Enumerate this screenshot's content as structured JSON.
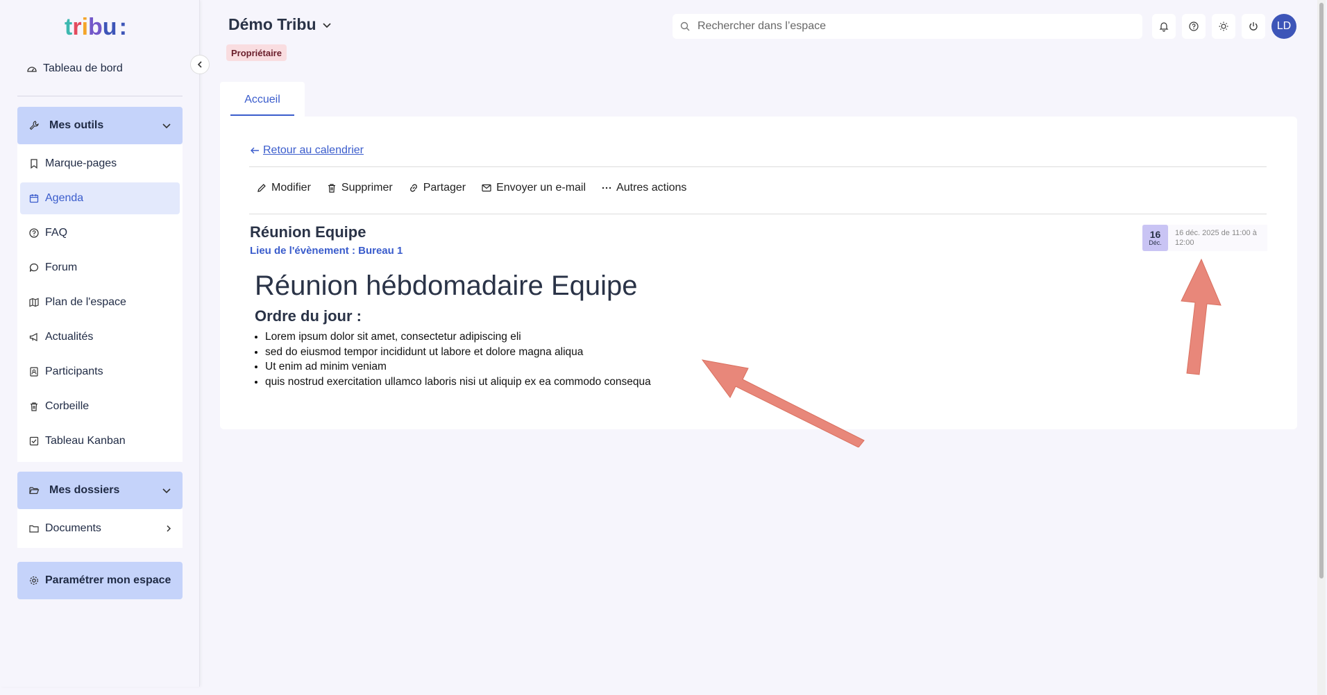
{
  "logo": {
    "text": "tribu:",
    "colors": [
      "#3db8b0",
      "#e34b5d",
      "#f4a52a",
      "#7357c9",
      "#3d55b8"
    ]
  },
  "sidebar": {
    "dashboard": "Tableau de bord",
    "tools_section": {
      "label": "Mes outils",
      "items": [
        {
          "label": "Marque-pages",
          "icon": "bookmark-icon"
        },
        {
          "label": "Agenda",
          "icon": "calendar-icon",
          "active": true
        },
        {
          "label": "FAQ",
          "icon": "help-circle-icon"
        },
        {
          "label": "Forum",
          "icon": "chat-icon"
        },
        {
          "label": "Plan de l'espace",
          "icon": "map-icon"
        },
        {
          "label": "Actualités",
          "icon": "megaphone-icon"
        },
        {
          "label": "Participants",
          "icon": "contacts-icon"
        },
        {
          "label": "Corbeille",
          "icon": "trash-icon"
        },
        {
          "label": "Tableau Kanban",
          "icon": "checkbox-icon"
        }
      ]
    },
    "folders_section": {
      "label": "Mes dossiers",
      "items": [
        {
          "label": "Documents",
          "icon": "folder-icon"
        }
      ]
    },
    "settings_button": "Paramétrer mon espace"
  },
  "header": {
    "space_title": "Démo Tribu",
    "role_badge": "Propriétaire",
    "search_placeholder": "Rechercher dans l’espace",
    "avatar_initials": "LD"
  },
  "tabs": [
    {
      "label": "Accueil",
      "active": true
    }
  ],
  "event": {
    "back_link": "Retour au calendrier",
    "actions": [
      {
        "label": "Modifier",
        "icon": "pencil-icon"
      },
      {
        "label": "Supprimer",
        "icon": "trash-icon"
      },
      {
        "label": "Partager",
        "icon": "link-icon"
      },
      {
        "label": "Envoyer un e-mail",
        "icon": "mail-icon"
      },
      {
        "label": "Autres actions",
        "icon": "more-dots-icon"
      }
    ],
    "title": "Réunion Equipe",
    "place": "Lieu de l'évènement : Bureau 1",
    "date_day": "16",
    "date_month": "Déc.",
    "date_text": "16 déc. 2025 de 11:00 à 12:00",
    "body_heading": "Réunion hébdomadaire Equipe",
    "agenda_heading": "Ordre du jour :",
    "agenda_items": [
      "Lorem ipsum dolor sit amet, consectetur adipiscing eli",
      "sed do eiusmod tempor incididunt ut labore et dolore magna aliqua",
      "Ut enim ad minim veniam",
      "quis nostrud exercitation ullamco laboris nisi ut aliquip ex ea commodo consequa"
    ]
  },
  "colors": {
    "accent": "#3a5ccc",
    "section_bg": "#c5d3fa",
    "arrow": "#e8877a"
  }
}
